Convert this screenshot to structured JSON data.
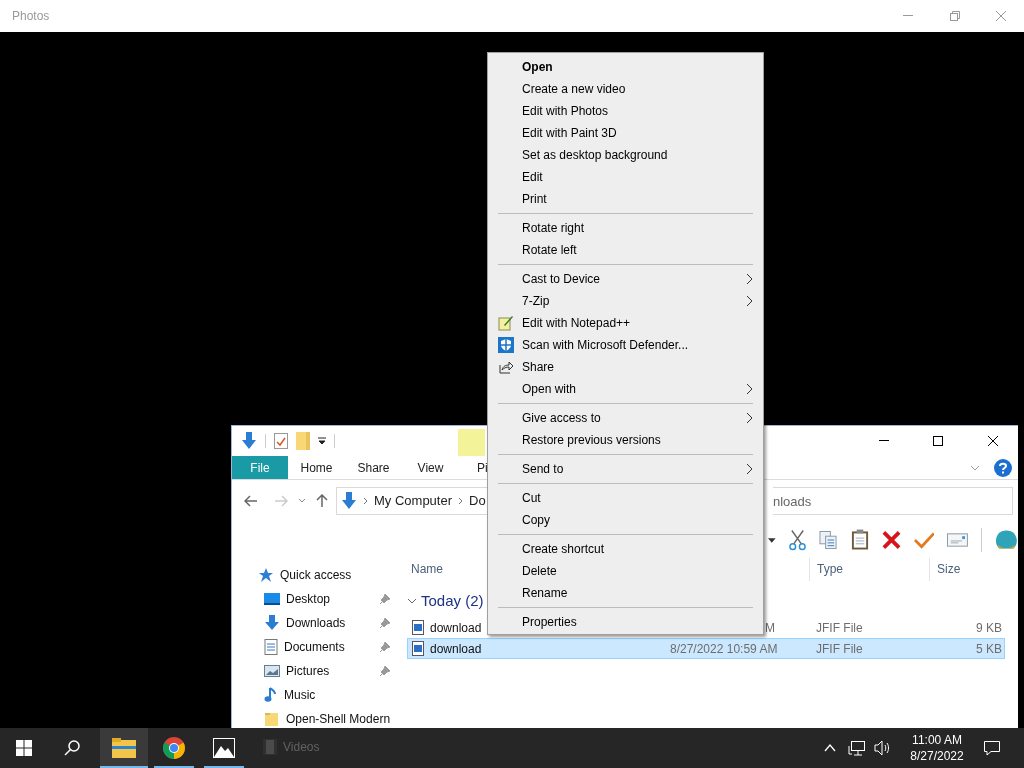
{
  "photos_window": {
    "title": "Photos"
  },
  "context_menu": [
    {
      "kind": "plain",
      "label": "Open",
      "default": true,
      "submenu": false
    },
    {
      "kind": "plain",
      "label": "Create a new video",
      "default": false,
      "submenu": false
    },
    {
      "kind": "plain",
      "label": "Edit with Photos",
      "default": false,
      "submenu": false
    },
    {
      "kind": "plain",
      "label": "Edit with Paint 3D",
      "default": false,
      "submenu": false
    },
    {
      "kind": "plain",
      "label": "Set as desktop background",
      "default": false,
      "submenu": false
    },
    {
      "kind": "plain",
      "label": "Edit",
      "default": false,
      "submenu": false
    },
    {
      "kind": "plain",
      "label": "Print",
      "default": false,
      "submenu": false
    },
    {
      "kind": "separator"
    },
    {
      "kind": "plain",
      "label": "Rotate right",
      "default": false,
      "submenu": false
    },
    {
      "kind": "plain",
      "label": "Rotate left",
      "default": false,
      "submenu": false
    },
    {
      "kind": "separator"
    },
    {
      "kind": "plain",
      "label": "Cast to Device",
      "default": false,
      "submenu": true
    },
    {
      "kind": "plain",
      "label": "7-Zip",
      "default": false,
      "submenu": true
    },
    {
      "kind": "notepad",
      "label": "Edit with Notepad++",
      "default": false,
      "submenu": false
    },
    {
      "kind": "shield",
      "label": "Scan with Microsoft Defender...",
      "default": false,
      "submenu": false
    },
    {
      "kind": "share",
      "label": "Share",
      "default": false,
      "submenu": false
    },
    {
      "kind": "plain",
      "label": "Open with",
      "default": false,
      "submenu": true
    },
    {
      "kind": "separator"
    },
    {
      "kind": "plain",
      "label": "Give access to",
      "default": false,
      "submenu": true
    },
    {
      "kind": "plain",
      "label": "Restore previous versions",
      "default": false,
      "submenu": false
    },
    {
      "kind": "separator"
    },
    {
      "kind": "plain",
      "label": "Send to",
      "default": false,
      "submenu": true
    },
    {
      "kind": "separator"
    },
    {
      "kind": "plain",
      "label": "Cut",
      "default": false,
      "submenu": false
    },
    {
      "kind": "plain",
      "label": "Copy",
      "default": false,
      "submenu": false
    },
    {
      "kind": "separator"
    },
    {
      "kind": "plain",
      "label": "Create shortcut",
      "default": false,
      "submenu": false
    },
    {
      "kind": "plain",
      "label": "Delete",
      "default": false,
      "submenu": false
    },
    {
      "kind": "plain",
      "label": "Rename",
      "default": false,
      "submenu": false
    },
    {
      "kind": "separator"
    },
    {
      "kind": "plain",
      "label": "Properties",
      "default": false,
      "submenu": false
    }
  ],
  "explorer": {
    "ribbon_tabs": [
      {
        "label": "File",
        "selected": true
      },
      {
        "label": "Home",
        "selected": false
      },
      {
        "label": "Share",
        "selected": false
      },
      {
        "label": "View",
        "selected": false
      },
      {
        "label": "Pi",
        "selected": false
      }
    ],
    "address": [
      "My Computer",
      "Do"
    ],
    "search": {
      "placeholder": "nloads"
    },
    "nav": [
      {
        "kind": "star",
        "label": "Quick access",
        "pinned": false
      },
      {
        "kind": "desktop",
        "label": "Desktop",
        "pinned": true
      },
      {
        "kind": "download",
        "label": "Downloads",
        "pinned": true
      },
      {
        "kind": "document",
        "label": "Documents",
        "pinned": true
      },
      {
        "kind": "picture",
        "label": "Pictures",
        "pinned": true
      },
      {
        "kind": "music",
        "label": "Music",
        "pinned": false
      },
      {
        "kind": "folder",
        "label": "Open-Shell Modern",
        "pinned": false
      },
      {
        "kind": "video",
        "label": "Videos",
        "pinned": false
      }
    ],
    "columns": {
      "name": "Name",
      "type": "Type",
      "size": "Size"
    },
    "group": {
      "label": "Today (2)",
      "expanded": true
    },
    "files": [
      {
        "name": "download",
        "date": "M",
        "type": "JFIF File",
        "size": "9 KB",
        "selected": false
      },
      {
        "name": "download",
        "date": "8/27/2022 10:59 AM",
        "type": "JFIF File",
        "size": "5 KB",
        "selected": true
      }
    ]
  },
  "taskbar": {
    "apps": [
      {
        "kind": "explorer",
        "active": true,
        "running": true
      },
      {
        "kind": "chrome",
        "active": false,
        "running": true
      },
      {
        "kind": "photos",
        "active": false,
        "running": true
      }
    ],
    "time": "11:00 AM",
    "date": "8/27/2022"
  }
}
